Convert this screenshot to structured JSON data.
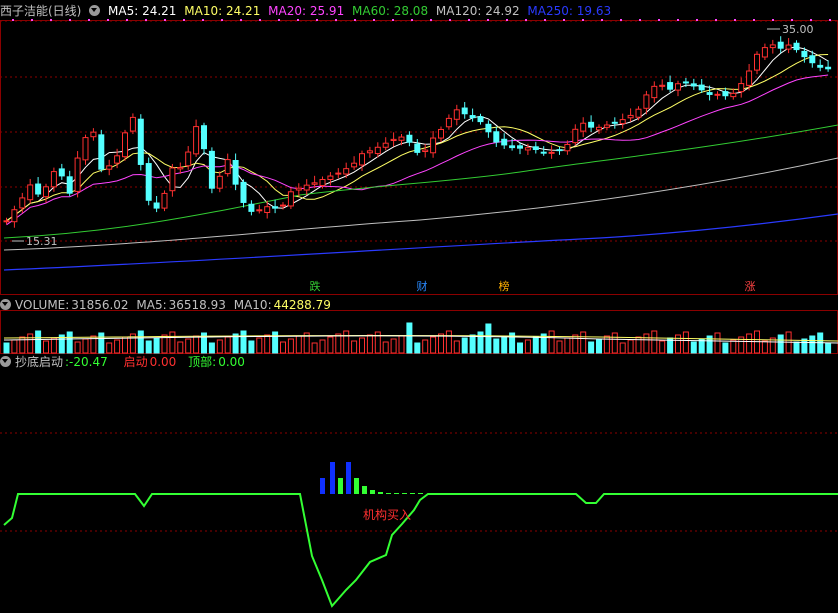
{
  "stock": {
    "title": "西子洁能(日线)"
  },
  "main_indicators": [
    {
      "label": "MA5: 24.21",
      "color": "#ffffff"
    },
    {
      "label": "MA10: 24.21",
      "color": "#ffff66"
    },
    {
      "label": "MA20: 25.91",
      "color": "#ff44ff"
    },
    {
      "label": "MA60: 28.08",
      "color": "#33cc33"
    },
    {
      "label": "MA120: 24.92",
      "color": "#c0c0c0"
    },
    {
      "label": "MA250: 19.63",
      "color": "#2a3aff"
    }
  ],
  "price_marks": {
    "high": "35.00",
    "low": "15.31"
  },
  "events": [
    {
      "label": "跌",
      "color": "#33cc33"
    },
    {
      "label": "财",
      "color": "#2a8aff"
    },
    {
      "label": "榜",
      "color": "#ffb000"
    },
    {
      "label": "涨",
      "color": "#ff4444"
    }
  ],
  "volume_panel": {
    "name": "VOLUME:",
    "value": "31856.02",
    "ma5_label": "MA5:",
    "ma5": "36518.93",
    "ma10_label": "MA10:",
    "ma10": "44288.79"
  },
  "indicator_panel": {
    "name": "抄底启动",
    "value": ":-20.47",
    "qidong_label": "启动",
    "qidong": "0.00",
    "dingbu_label": "顶部:",
    "dingbu": "0.00",
    "signal_text": "机构买入"
  },
  "colors": {
    "up": "#ff3030",
    "down": "#54ffff",
    "grid": "#8b0000",
    "signal": "#33ff33"
  },
  "chart_data": {
    "type": "candlestick",
    "price_axis": {
      "min": 15.31,
      "max": 35.0
    },
    "price_guides": [
      {
        "price": 35.0,
        "label": "35.00"
      },
      {
        "price": 15.31,
        "label": "15.31"
      }
    ],
    "volume_summary": {
      "VOLUME": 31856.02,
      "MA5": 36518.93,
      "MA10": 44288.79
    },
    "indicator_summary": {
      "抄底启动": -20.47,
      "启动": 0.0,
      "顶部": 0.0
    }
  }
}
